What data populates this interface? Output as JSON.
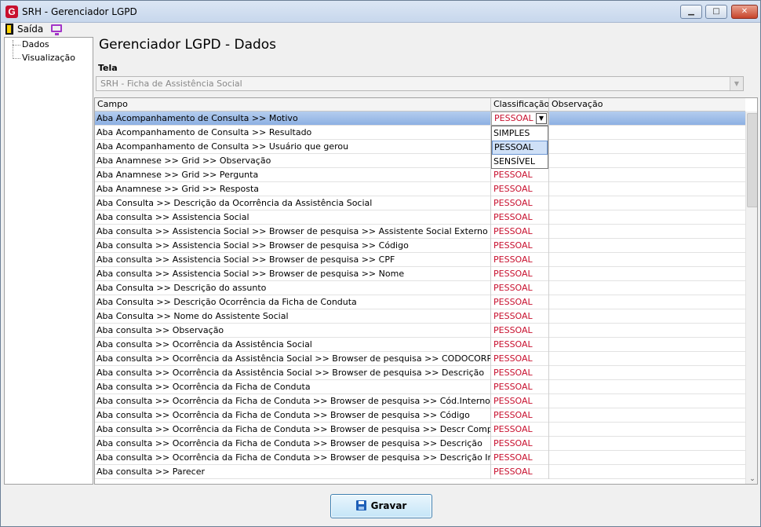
{
  "window": {
    "title": "SRH - Gerenciador LGPD",
    "logo_letter": "G",
    "controls": {
      "minimize": "▁",
      "maximize": "□",
      "close": "✕"
    }
  },
  "menu": {
    "exit_label": "Saída"
  },
  "nav": {
    "items": [
      {
        "label": "Dados"
      },
      {
        "label": "Visualização"
      }
    ]
  },
  "page": {
    "title": "Gerenciador LGPD - Dados"
  },
  "tela": {
    "label": "Tela",
    "selected": "SRH - Ficha de Assistência Social"
  },
  "grid": {
    "columns": {
      "campo": "Campo",
      "classificacao": "Classificação",
      "observacao": "Observação"
    },
    "selected_row": 0,
    "rows": [
      {
        "campo": "Aba Acompanhamento de Consulta >> Motivo",
        "classificacao": "PESSOAL",
        "observacao": ""
      },
      {
        "campo": "Aba Acompanhamento de Consulta >> Resultado",
        "classificacao": "",
        "observacao": ""
      },
      {
        "campo": "Aba Acompanhamento de Consulta >> Usuário que gerou",
        "classificacao": "",
        "observacao": ""
      },
      {
        "campo": "Aba Anamnese >> Grid >> Observação",
        "classificacao": "",
        "observacao": ""
      },
      {
        "campo": "Aba Anamnese >> Grid >> Pergunta",
        "classificacao": "PESSOAL",
        "observacao": ""
      },
      {
        "campo": "Aba Anamnese >> Grid >> Resposta",
        "classificacao": "PESSOAL",
        "observacao": ""
      },
      {
        "campo": "Aba Consulta >>  Descrição da Ocorrência da Assistência Social",
        "classificacao": "PESSOAL",
        "observacao": ""
      },
      {
        "campo": "Aba consulta >> Assistencia Social",
        "classificacao": "PESSOAL",
        "observacao": ""
      },
      {
        "campo": "Aba consulta >> Assistencia Social >> Browser de pesquisa >> Assistente Social Externo",
        "classificacao": "PESSOAL",
        "observacao": ""
      },
      {
        "campo": "Aba consulta >> Assistencia Social >> Browser de pesquisa >> Código",
        "classificacao": "PESSOAL",
        "observacao": ""
      },
      {
        "campo": "Aba consulta >> Assistencia Social >> Browser de pesquisa >> CPF",
        "classificacao": "PESSOAL",
        "observacao": ""
      },
      {
        "campo": "Aba consulta >> Assistencia Social >> Browser de pesquisa >> Nome",
        "classificacao": "PESSOAL",
        "observacao": ""
      },
      {
        "campo": "Aba Consulta >> Descrição do assunto",
        "classificacao": "PESSOAL",
        "observacao": ""
      },
      {
        "campo": "Aba Consulta >> Descrição Ocorrência da Ficha de Conduta",
        "classificacao": "PESSOAL",
        "observacao": ""
      },
      {
        "campo": "Aba Consulta >> Nome do Assistente Social",
        "classificacao": "PESSOAL",
        "observacao": ""
      },
      {
        "campo": "Aba consulta >> Observação",
        "classificacao": "PESSOAL",
        "observacao": ""
      },
      {
        "campo": "Aba consulta >> Ocorrência da Assistência Social",
        "classificacao": "PESSOAL",
        "observacao": ""
      },
      {
        "campo": "Aba consulta >> Ocorrência da Assistência Social >> Browser de pesquisa >> CODOCORR",
        "classificacao": "PESSOAL",
        "observacao": ""
      },
      {
        "campo": "Aba consulta >> Ocorrência da Assistência Social >> Browser de pesquisa >> Descrição",
        "classificacao": "PESSOAL",
        "observacao": ""
      },
      {
        "campo": "Aba consulta >> Ocorrência da Ficha de Conduta",
        "classificacao": "PESSOAL",
        "observacao": ""
      },
      {
        "campo": "Aba consulta >> Ocorrência da Ficha de Conduta >> Browser de pesquisa >> Cód.Interno",
        "classificacao": "PESSOAL",
        "observacao": ""
      },
      {
        "campo": "Aba consulta >> Ocorrência da Ficha de Conduta >> Browser de pesquisa >> Código",
        "classificacao": "PESSOAL",
        "observacao": ""
      },
      {
        "campo": "Aba consulta >> Ocorrência da Ficha de Conduta >> Browser de pesquisa >> Descr Completa",
        "classificacao": "PESSOAL",
        "observacao": ""
      },
      {
        "campo": "Aba consulta >> Ocorrência da Ficha de Conduta >> Browser de pesquisa >> Descrição",
        "classificacao": "PESSOAL",
        "observacao": ""
      },
      {
        "campo": "Aba consulta >> Ocorrência da Ficha de Conduta >> Browser de pesquisa >> Descrição Interna",
        "classificacao": "PESSOAL",
        "observacao": ""
      },
      {
        "campo": "Aba consulta >> Parecer",
        "classificacao": "PESSOAL",
        "observacao": ""
      }
    ],
    "editor": {
      "value": "PESSOAL",
      "arrow": "▼"
    },
    "dropdown_options": [
      {
        "label": "SIMPLES",
        "hover": false
      },
      {
        "label": "PESSOAL",
        "hover": true
      },
      {
        "label": "SENSÍVEL",
        "hover": false
      }
    ],
    "scroll_down_glyph": "⌄"
  },
  "actions": {
    "save_label": "Gravar"
  },
  "colors": {
    "classification_text": "#c8102e",
    "selection": "#8db0e3",
    "logo": "#c8102e"
  }
}
